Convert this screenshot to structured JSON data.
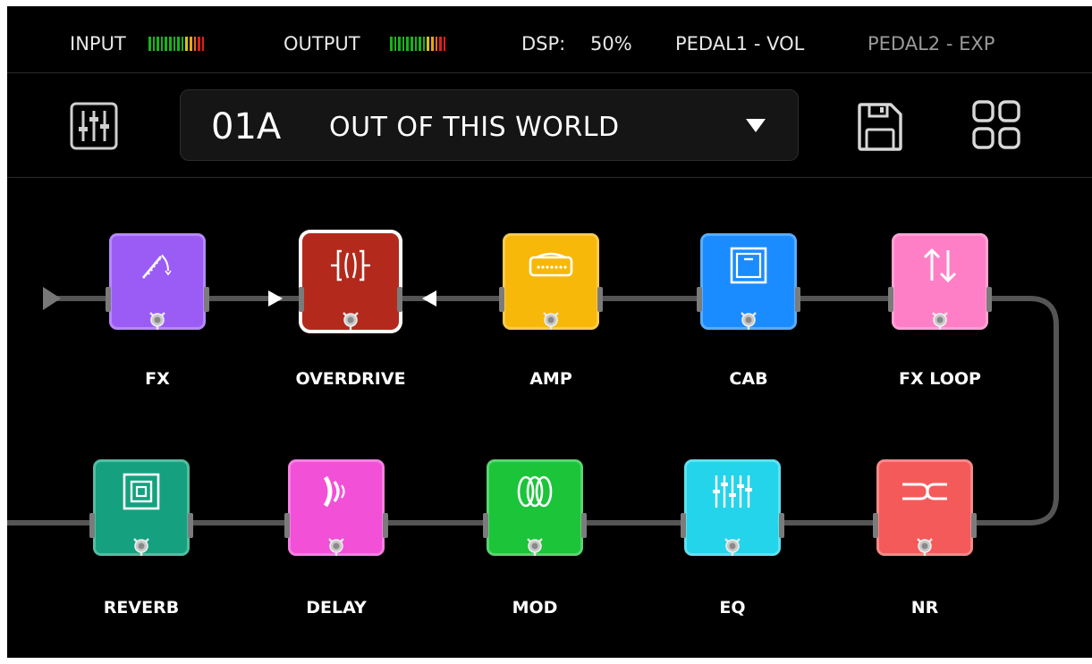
{
  "status": {
    "input_label": "INPUT",
    "output_label": "OUTPUT",
    "dsp_label": "DSP:",
    "dsp_value": "50%",
    "pedal1": "PEDAL1 - VOL",
    "pedal2": "PEDAL2 - EXP",
    "meter_colors": [
      "#18b21c",
      "#18b21c",
      "#18b21c",
      "#18b21c",
      "#18b21c",
      "#18b21c",
      "#18b21c",
      "#18b21c",
      "#18b21c",
      "#d7c21a",
      "#e7a515",
      "#e36b18",
      "#e01f1f",
      "#e01f1f"
    ]
  },
  "preset": {
    "number": "01A",
    "name": "OUT OF THIS WORLD"
  },
  "icons": {
    "mixer": "mixer-icon",
    "save": "save-icon",
    "grid": "grid-view-icon",
    "dropdown": "triangle-down-icon"
  },
  "pedals_row1": [
    {
      "label": "FX",
      "color": "#9b5cf6",
      "icon": "fx-pitch-icon",
      "selected": false
    },
    {
      "label": "OVERDRIVE",
      "color": "#b32a1d",
      "icon": "overdrive-icon",
      "selected": true
    },
    {
      "label": "AMP",
      "color": "#f7b80a",
      "icon": "amp-icon",
      "selected": false
    },
    {
      "label": "CAB",
      "color": "#1a8cff",
      "icon": "cab-icon",
      "selected": false
    },
    {
      "label": "FX LOOP",
      "color": "#ff7fc7",
      "icon": "fx-loop-icon",
      "selected": false
    }
  ],
  "pedals_row2": [
    {
      "label": "REVERB",
      "color": "#15a17f",
      "icon": "reverb-icon",
      "selected": false
    },
    {
      "label": "DELAY",
      "color": "#f250d7",
      "icon": "delay-icon",
      "selected": false
    },
    {
      "label": "MOD",
      "color": "#1cc43a",
      "icon": "mod-icon",
      "selected": false
    },
    {
      "label": "EQ",
      "color": "#24d4ea",
      "icon": "eq-icon",
      "selected": false
    },
    {
      "label": "NR",
      "color": "#f45a5a",
      "icon": "noise-reduction-icon",
      "selected": false
    }
  ]
}
